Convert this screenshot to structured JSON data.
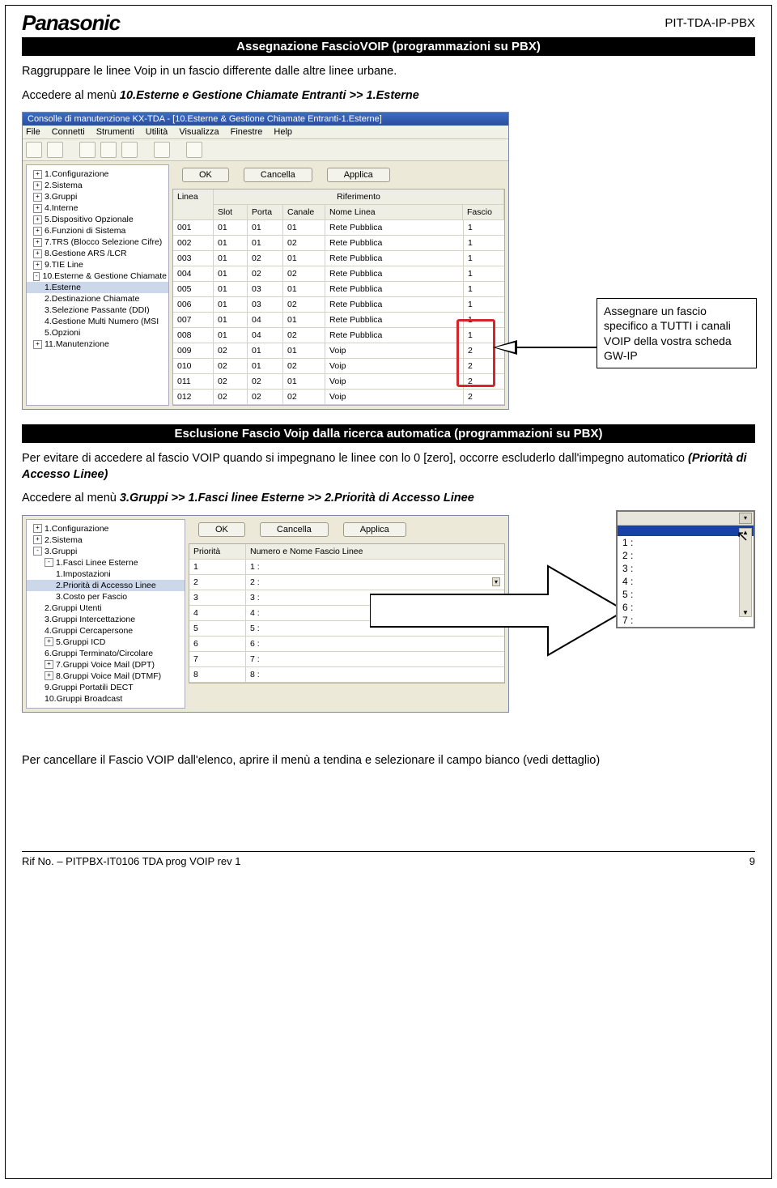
{
  "header": {
    "brand": "Panasonic",
    "doc_code": "PIT-TDA-IP-PBX"
  },
  "banner1": "Assegnazione FascioVOIP (programmazioni su PBX)",
  "intro_lines": [
    "Raggruppare le linee Voip in un fascio differente dalle altre linee urbane.",
    "Accedere al menù 10.Esterne e Gestione Chiamate Entranti >> 1.Esterne"
  ],
  "callout1": "Assegnare un fascio specifico a TUTTI i canali VOIP della vostra scheda GW-IP",
  "app1": {
    "title": "Consolle di manutenzione KX-TDA - [10.Esterne & Gestione Chiamate Entranti-1.Esterne]",
    "menus": [
      "File",
      "Connetti",
      "Strumenti",
      "Utilità",
      "Visualizza",
      "Finestre",
      "Help"
    ],
    "buttons": {
      "ok": "OK",
      "cancel": "Cancella",
      "apply": "Applica"
    },
    "tree": [
      {
        "pre": "+",
        "label": "1.Configurazione"
      },
      {
        "pre": "+",
        "label": "2.Sistema"
      },
      {
        "pre": "+",
        "label": "3.Gruppi"
      },
      {
        "pre": "+",
        "label": "4.Interne"
      },
      {
        "pre": "+",
        "label": "5.Dispositivo Opzionale"
      },
      {
        "pre": "+",
        "label": "6.Funzioni di Sistema"
      },
      {
        "pre": "+",
        "label": "7.TRS (Blocco Selezione Cifre)"
      },
      {
        "pre": "+",
        "label": "8.Gestione ARS /LCR"
      },
      {
        "pre": "+",
        "label": "9.TIE Line"
      },
      {
        "pre": "-",
        "label": "10.Esterne & Gestione Chiamate"
      },
      {
        "pre": "",
        "label": "1.Esterne",
        "cls": "child sel"
      },
      {
        "pre": "",
        "label": "2.Destinazione Chiamate",
        "cls": "child"
      },
      {
        "pre": "",
        "label": "3.Selezione Passante (DDI)",
        "cls": "child"
      },
      {
        "pre": "",
        "label": "4.Gestione Multi Numero (MSI",
        "cls": "child"
      },
      {
        "pre": "",
        "label": "5.Opzioni",
        "cls": "child"
      },
      {
        "pre": "+",
        "label": "11.Manutenzione"
      }
    ],
    "grid_headers": {
      "linea": "Linea",
      "rif": "Riferimento",
      "slot": "Slot",
      "porta": "Porta",
      "canale": "Canale",
      "nome": "Nome Linea",
      "fascio": "Fascio"
    },
    "rows": [
      {
        "linea": "001",
        "slot": "01",
        "porta": "01",
        "canale": "01",
        "nome": "Rete Pubblica",
        "fascio": "1"
      },
      {
        "linea": "002",
        "slot": "01",
        "porta": "01",
        "canale": "02",
        "nome": "Rete Pubblica",
        "fascio": "1"
      },
      {
        "linea": "003",
        "slot": "01",
        "porta": "02",
        "canale": "01",
        "nome": "Rete Pubblica",
        "fascio": "1"
      },
      {
        "linea": "004",
        "slot": "01",
        "porta": "02",
        "canale": "02",
        "nome": "Rete Pubblica",
        "fascio": "1"
      },
      {
        "linea": "005",
        "slot": "01",
        "porta": "03",
        "canale": "01",
        "nome": "Rete Pubblica",
        "fascio": "1"
      },
      {
        "linea": "006",
        "slot": "01",
        "porta": "03",
        "canale": "02",
        "nome": "Rete Pubblica",
        "fascio": "1"
      },
      {
        "linea": "007",
        "slot": "01",
        "porta": "04",
        "canale": "01",
        "nome": "Rete Pubblica",
        "fascio": "1"
      },
      {
        "linea": "008",
        "slot": "01",
        "porta": "04",
        "canale": "02",
        "nome": "Rete Pubblica",
        "fascio": "1"
      },
      {
        "linea": "009",
        "slot": "02",
        "porta": "01",
        "canale": "01",
        "nome": "Voip",
        "fascio": "2"
      },
      {
        "linea": "010",
        "slot": "02",
        "porta": "01",
        "canale": "02",
        "nome": "Voip",
        "fascio": "2"
      },
      {
        "linea": "011",
        "slot": "02",
        "porta": "02",
        "canale": "01",
        "nome": "Voip",
        "fascio": "2"
      },
      {
        "linea": "012",
        "slot": "02",
        "porta": "02",
        "canale": "02",
        "nome": "Voip",
        "fascio": "2"
      }
    ]
  },
  "banner2": "Esclusione Fascio Voip dalla ricerca automatica (programmazioni su PBX)",
  "para2_a": "Per evitare di accedere al fascio VOIP quando si impegnano le linee con lo 0 [zero], occorre escluderlo dall'impegno automatico ",
  "para2_b": "(Priorità di Accesso Linee)",
  "para3": "Accedere al menù 3.Gruppi >> 1.Fasci linee Esterne >> 2.Priorità di Accesso Linee",
  "app2": {
    "tree": [
      {
        "pre": "+",
        "label": "1.Configurazione"
      },
      {
        "pre": "+",
        "label": "2.Sistema"
      },
      {
        "pre": "-",
        "label": "3.Gruppi"
      },
      {
        "pre": "-",
        "label": "1.Fasci Linee Esterne",
        "cls": "child"
      },
      {
        "pre": "",
        "label": "1.Impostazioni",
        "cls": "child2"
      },
      {
        "pre": "",
        "label": "2.Priorità di Accesso Linee",
        "cls": "child2 sel"
      },
      {
        "pre": "",
        "label": "3.Costo per Fascio",
        "cls": "child2"
      },
      {
        "pre": "",
        "label": "2.Gruppi Utenti",
        "cls": "child"
      },
      {
        "pre": "",
        "label": "3.Gruppi Intercettazione",
        "cls": "child"
      },
      {
        "pre": "",
        "label": "4.Gruppi Cercapersone",
        "cls": "child"
      },
      {
        "pre": "+",
        "label": "5.Gruppi ICD",
        "cls": "child"
      },
      {
        "pre": "",
        "label": "6.Gruppi Terminato/Circolare",
        "cls": "child"
      },
      {
        "pre": "+",
        "label": "7.Gruppi Voice Mail (DPT)",
        "cls": "child"
      },
      {
        "pre": "+",
        "label": "8.Gruppi Voice Mail (DTMF)",
        "cls": "child"
      },
      {
        "pre": "",
        "label": "9.Gruppi Portatili DECT",
        "cls": "child"
      },
      {
        "pre": "",
        "label": "10.Gruppi Broadcast",
        "cls": "child"
      }
    ],
    "buttons": {
      "ok": "OK",
      "cancel": "Cancella",
      "apply": "Applica"
    },
    "grid_headers": {
      "prio": "Priorità",
      "num": "Numero e Nome Fascio Linee"
    },
    "rows": [
      {
        "prio": "1",
        "num": "1 :"
      },
      {
        "prio": "2",
        "num": "2 :"
      },
      {
        "prio": "3",
        "num": "3 :"
      },
      {
        "prio": "4",
        "num": "4 :"
      },
      {
        "prio": "5",
        "num": "5 :"
      },
      {
        "prio": "6",
        "num": "6 :"
      },
      {
        "prio": "7",
        "num": "7 :"
      },
      {
        "prio": "8",
        "num": "8 :"
      }
    ],
    "popup_options": [
      "1 :",
      "2 :",
      "3 :",
      "4 :",
      "5 :",
      "6 :",
      "7 :"
    ]
  },
  "bottom_para": "Per cancellare il Fascio VOIP dall'elenco, aprire il menù a tendina e selezionare il campo bianco (vedi dettaglio)",
  "footer": {
    "ref": "Rif No. – PITPBX-IT0106 TDA prog VOIP rev 1",
    "page": "9"
  }
}
